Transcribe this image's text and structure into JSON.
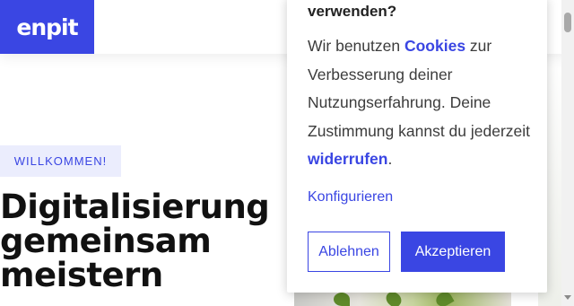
{
  "header": {
    "logo_text": "enpit"
  },
  "hero": {
    "badge": "WILLKOMMEN!",
    "title_lines": [
      "Digitalisierung",
      "gemeinsam",
      "meistern"
    ]
  },
  "cookie_banner": {
    "title": "verwenden?",
    "text_part1": "Wir benutzen ",
    "cookies_link": "Cookies",
    "text_part2": " zur Verbesserung deiner Nutzungserfahrung. Deine Zustimmung kannst du jederzeit ",
    "revoke_link": "widerrufen",
    "text_part3": ".",
    "configure_link": "Konfigurieren",
    "decline_button": "Ablehnen",
    "accept_button": "Akzeptieren"
  },
  "colors": {
    "brand": "#3a46e3",
    "badge_bg": "#ebedfd"
  }
}
